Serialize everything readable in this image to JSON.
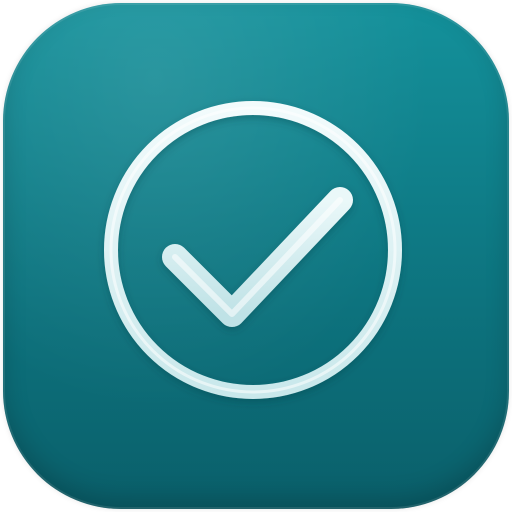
{
  "icon": {
    "name": "checkmark-app-icon",
    "glyph": "check-circle-icon",
    "colors": {
      "background_top": "#14919b",
      "background_bottom": "#0a5f6a",
      "glyph_fill": "#d7f0f2",
      "glyph_highlight": "#ffffff"
    }
  }
}
